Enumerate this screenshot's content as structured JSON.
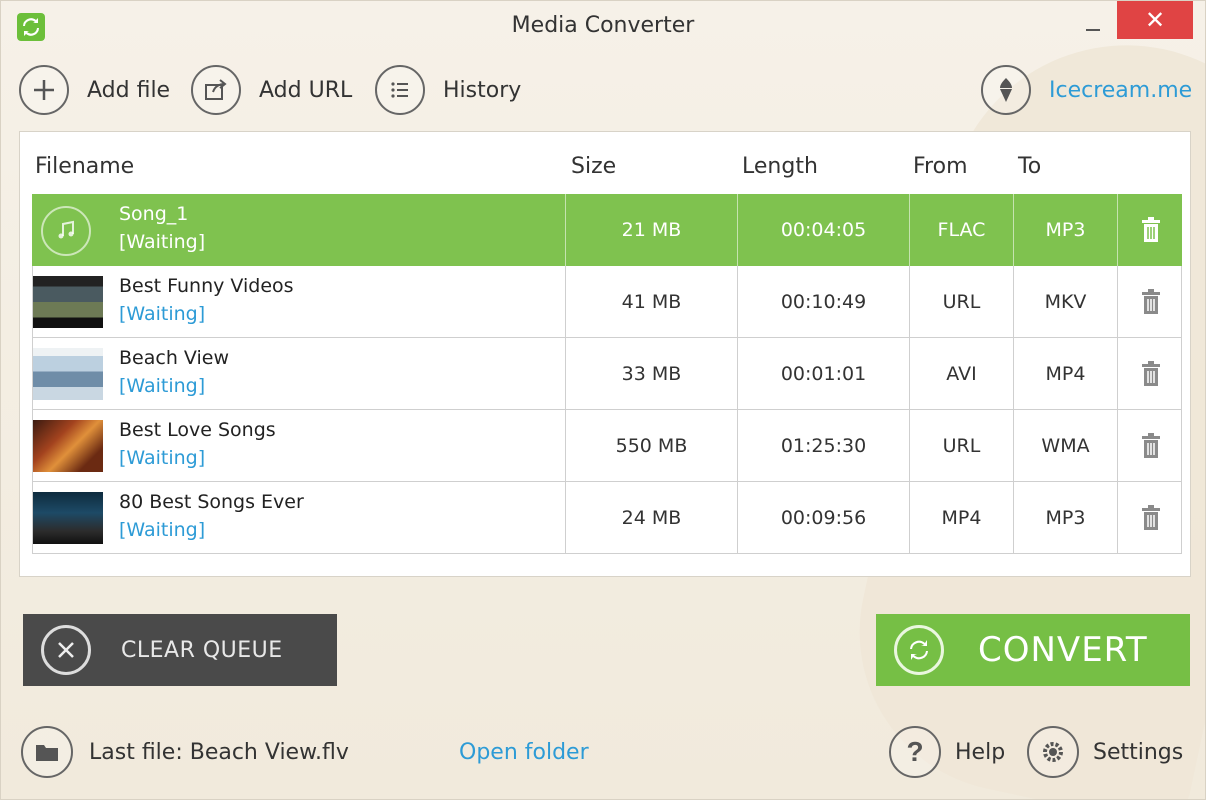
{
  "window": {
    "title": "Media Converter",
    "close_glyph": "✕"
  },
  "toolbar": {
    "add_file": "Add file",
    "add_url": "Add URL",
    "history": "History",
    "brand_link": "Icecream.me"
  },
  "table": {
    "headers": {
      "filename": "Filename",
      "size": "Size",
      "length": "Length",
      "from": "From",
      "to": "To"
    },
    "rows": [
      {
        "name": "Song_1",
        "status": "[Waiting]",
        "size": "21 MB",
        "length": "00:04:05",
        "from": "FLAC",
        "to": "MP3",
        "thumb": "music-icon"
      },
      {
        "name": "Best Funny Videos",
        "status": "[Waiting]",
        "size": "41 MB",
        "length": "00:10:49",
        "from": "URL",
        "to": "MKV",
        "thumb": "video-thumbnail"
      },
      {
        "name": "Beach View",
        "status": "[Waiting]",
        "size": "33 MB",
        "length": "00:01:01",
        "from": "AVI",
        "to": "MP4",
        "thumb": "video-thumbnail"
      },
      {
        "name": "Best Love Songs",
        "status": "[Waiting]",
        "size": "550 MB",
        "length": "01:25:30",
        "from": "URL",
        "to": "WMA",
        "thumb": "video-thumbnail"
      },
      {
        "name": "80 Best Songs Ever",
        "status": "[Waiting]",
        "size": "24 MB",
        "length": "00:09:56",
        "from": "MP4",
        "to": "MP3",
        "thumb": "video-thumbnail"
      }
    ]
  },
  "actions": {
    "clear_queue": "CLEAR QUEUE",
    "convert": "CONVERT"
  },
  "footer": {
    "last_file": "Last file: Beach View.flv",
    "open_folder": "Open folder",
    "help": "Help",
    "settings": "Settings"
  },
  "colors": {
    "accent_green": "#76bf45",
    "link_blue": "#2d9bd6",
    "close_red": "#e04444",
    "dark_button": "#4a4a4a"
  }
}
